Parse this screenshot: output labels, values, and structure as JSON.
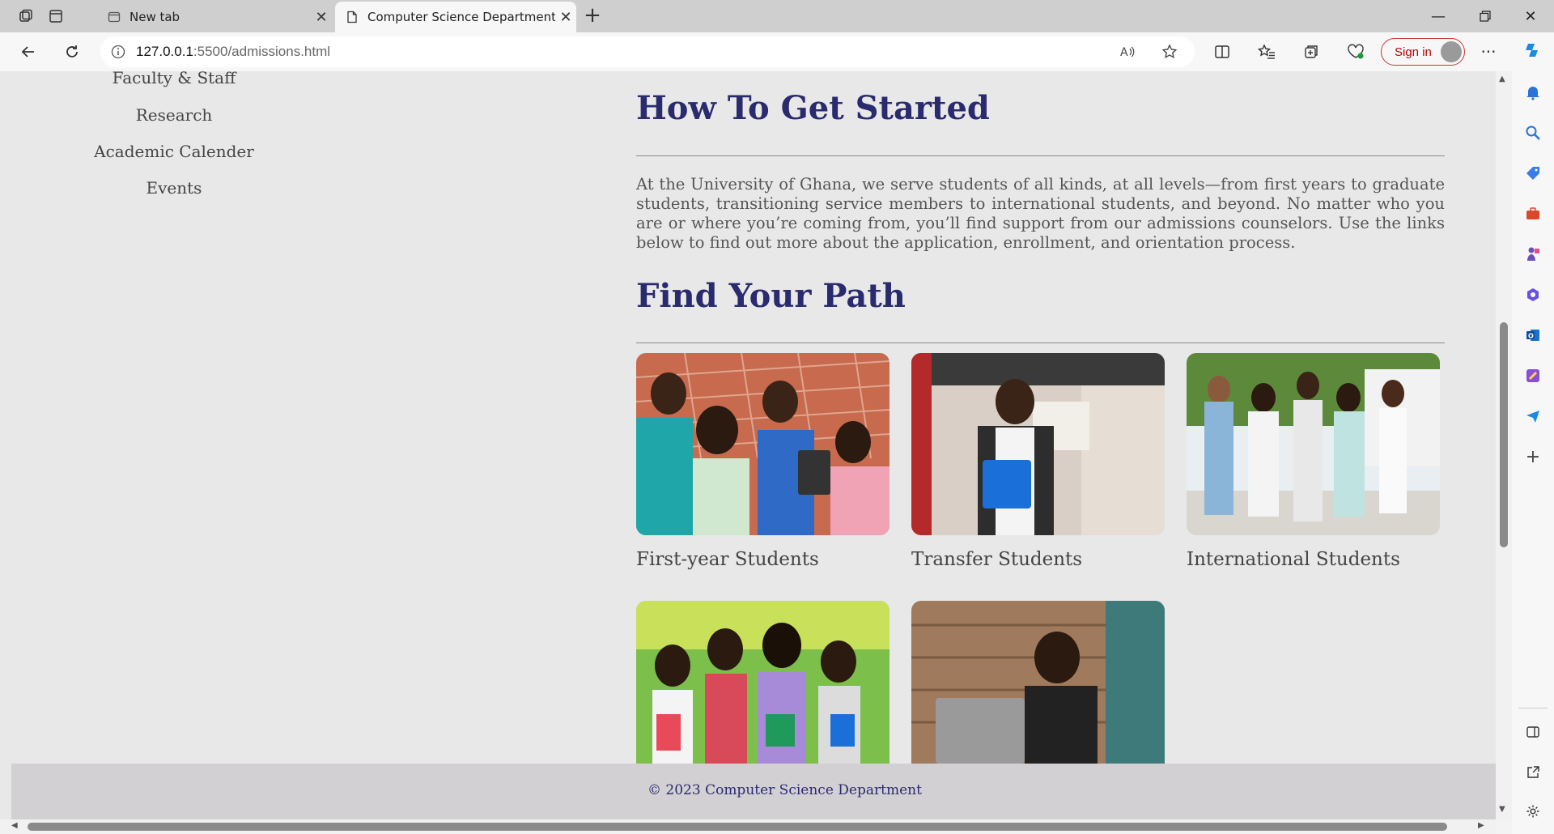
{
  "browser": {
    "tabs": [
      {
        "title": "New tab",
        "active": false
      },
      {
        "title": "Computer Science Department",
        "active": true
      }
    ],
    "address": {
      "host": "127.0.0.1",
      "path": ":5500/admissions.html"
    },
    "sign_in_label": "Sign in"
  },
  "nav": {
    "items": [
      "Faculty & Staff",
      "Research",
      "Academic Calender",
      "Events"
    ]
  },
  "main": {
    "heading_started": "How To Get Started",
    "intro": "At the University of Ghana, we serve students of all kinds, at all levels—from first years to graduate students, transitioning service members to international students, and beyond. No matter who you are or where you’re coming from, you’ll find support from our admissions counselors. Use the links below to find out more about the application, enrollment, and orientation process.",
    "heading_path": "Find Your Path",
    "paths": [
      {
        "label": "First-year Students"
      },
      {
        "label": "Transfer Students"
      },
      {
        "label": "International Students"
      },
      {
        "label": ""
      },
      {
        "label": ""
      }
    ]
  },
  "footer": {
    "text": "© 2023 Computer Science Department"
  },
  "colors": {
    "heading": "#2a2a6e",
    "page_bg": "#e8e8e8",
    "footer_bg": "#d3d0d3"
  }
}
